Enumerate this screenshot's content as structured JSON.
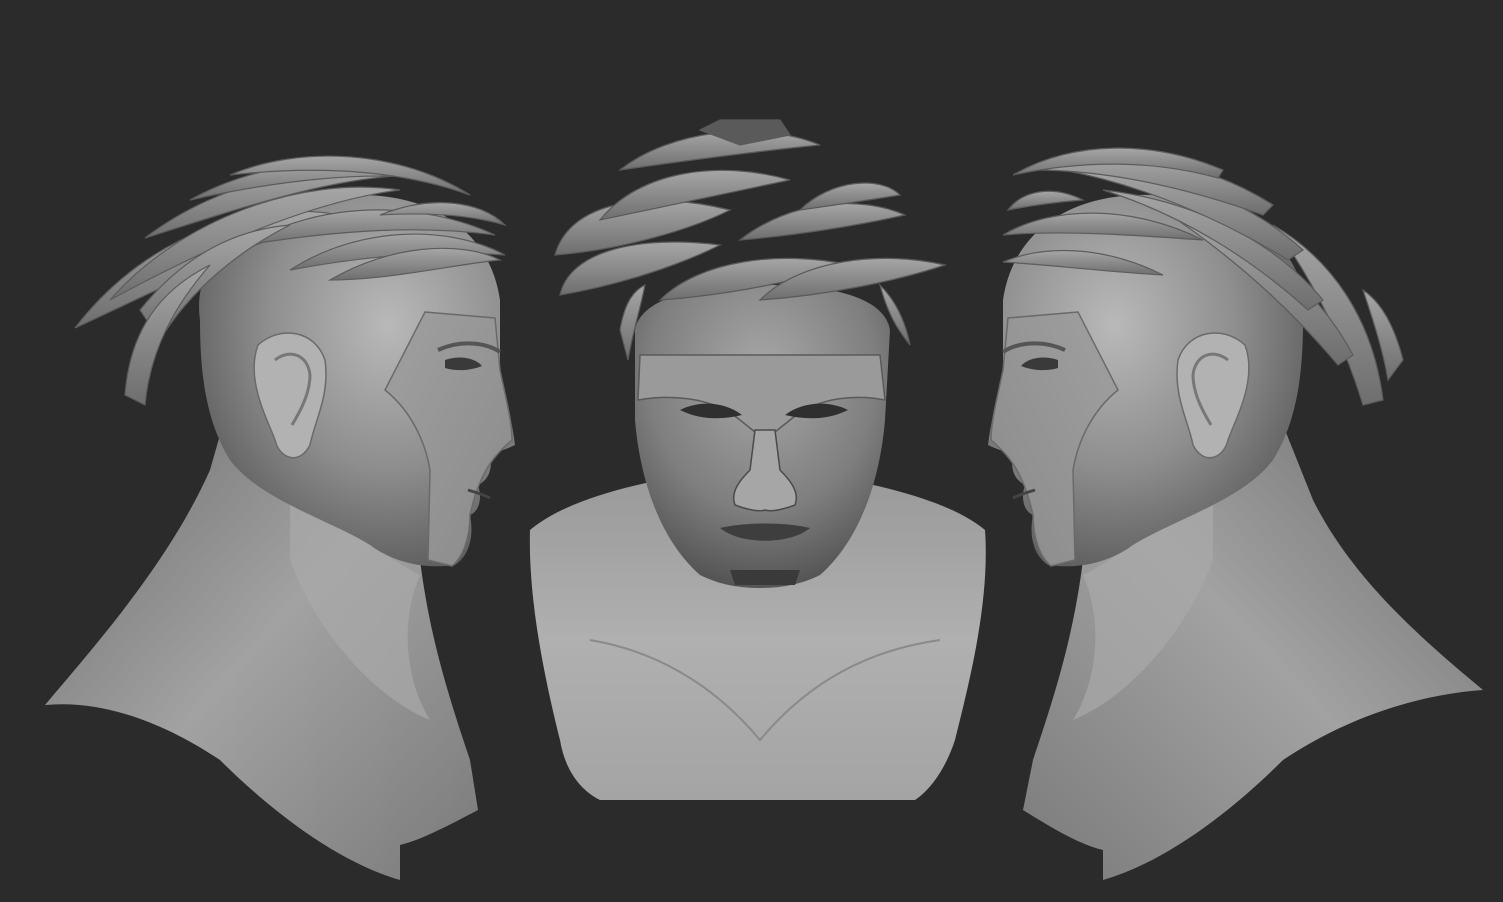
{
  "scene": {
    "background_color": "#2b2b2b",
    "clay_color": "#8c8c8c",
    "clay_light": "#b4b4b4",
    "clay_dark": "#4a4a4a",
    "views": [
      {
        "name": "left-profile-view",
        "facing": "right"
      },
      {
        "name": "front-view",
        "facing": "viewer"
      },
      {
        "name": "right-profile-view",
        "facing": "left"
      }
    ]
  }
}
